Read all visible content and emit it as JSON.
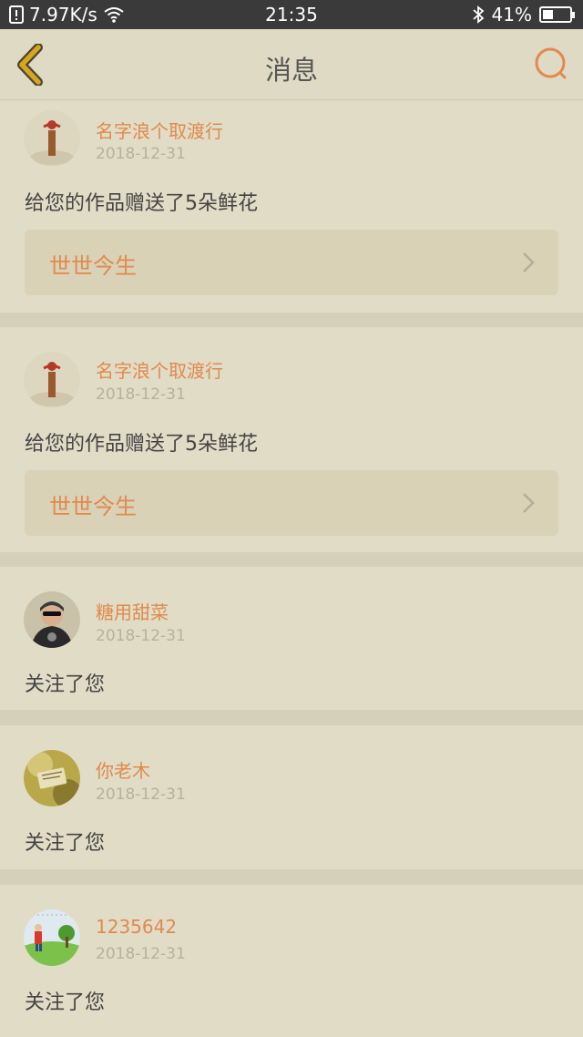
{
  "status_bar": {
    "network_speed": "7.97K/s",
    "time": "21:35",
    "battery_percent": "41%",
    "battery_level": 0.41
  },
  "nav": {
    "title": "消息"
  },
  "messages": [
    {
      "user": "名字浪个取渡行",
      "date": "2018-12-31",
      "text": "给您的作品赠送了5朵鲜花",
      "work": "世世今生"
    },
    {
      "user": "名字浪个取渡行",
      "date": "2018-12-31",
      "text": "给您的作品赠送了5朵鲜花",
      "work": "世世今生"
    },
    {
      "user": "糖用甜菜",
      "date": "2018-12-31",
      "text": "关注了您"
    },
    {
      "user": "你老木",
      "date": "2018-12-31",
      "text": "关注了您"
    },
    {
      "user": "1235642",
      "date": "2018-12-31",
      "text": "关注了您"
    }
  ],
  "colors": {
    "accent": "#e08a4f",
    "background": "#dfdac4",
    "back_icon": "#d9a520"
  }
}
